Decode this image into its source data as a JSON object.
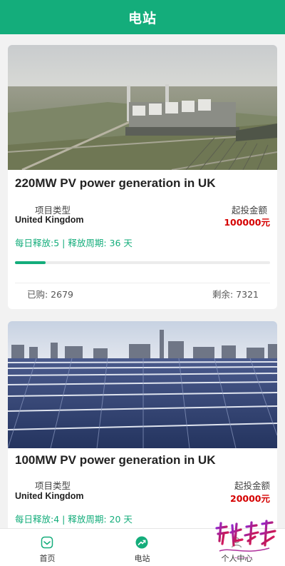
{
  "header": {
    "title": "电站"
  },
  "colors": {
    "accent": "#14ad7b",
    "amount": "#d50000"
  },
  "cards": [
    {
      "image": "coal-power-plant-photo",
      "title": "220MW PV power generation in UK",
      "type_label": "项目类型",
      "type_value": "United Kingdom",
      "min_label": "起投金额",
      "min_value": "100000元",
      "release_text": "每日释放:5 | 释放周期: 36 天",
      "progress_fraction": 0.12,
      "purchased": "已购: 2679",
      "remaining": "剩余: 7321"
    },
    {
      "image": "solar-farm-photo",
      "title": "100MW PV power generation in UK",
      "type_label": "项目类型",
      "type_value": "United Kingdom",
      "min_label": "起投金额",
      "min_value": "20000元",
      "release_text": "每日释放:4 | 释放周期: 20 天"
    }
  ],
  "tabbar": {
    "items": [
      {
        "label": "首页",
        "icon": "home-icon"
      },
      {
        "label": "电站",
        "icon": "trend-icon"
      },
      {
        "label": "个人中心",
        "icon": "user-icon"
      }
    ]
  },
  "watermark": {
    "text": "启航未来"
  }
}
